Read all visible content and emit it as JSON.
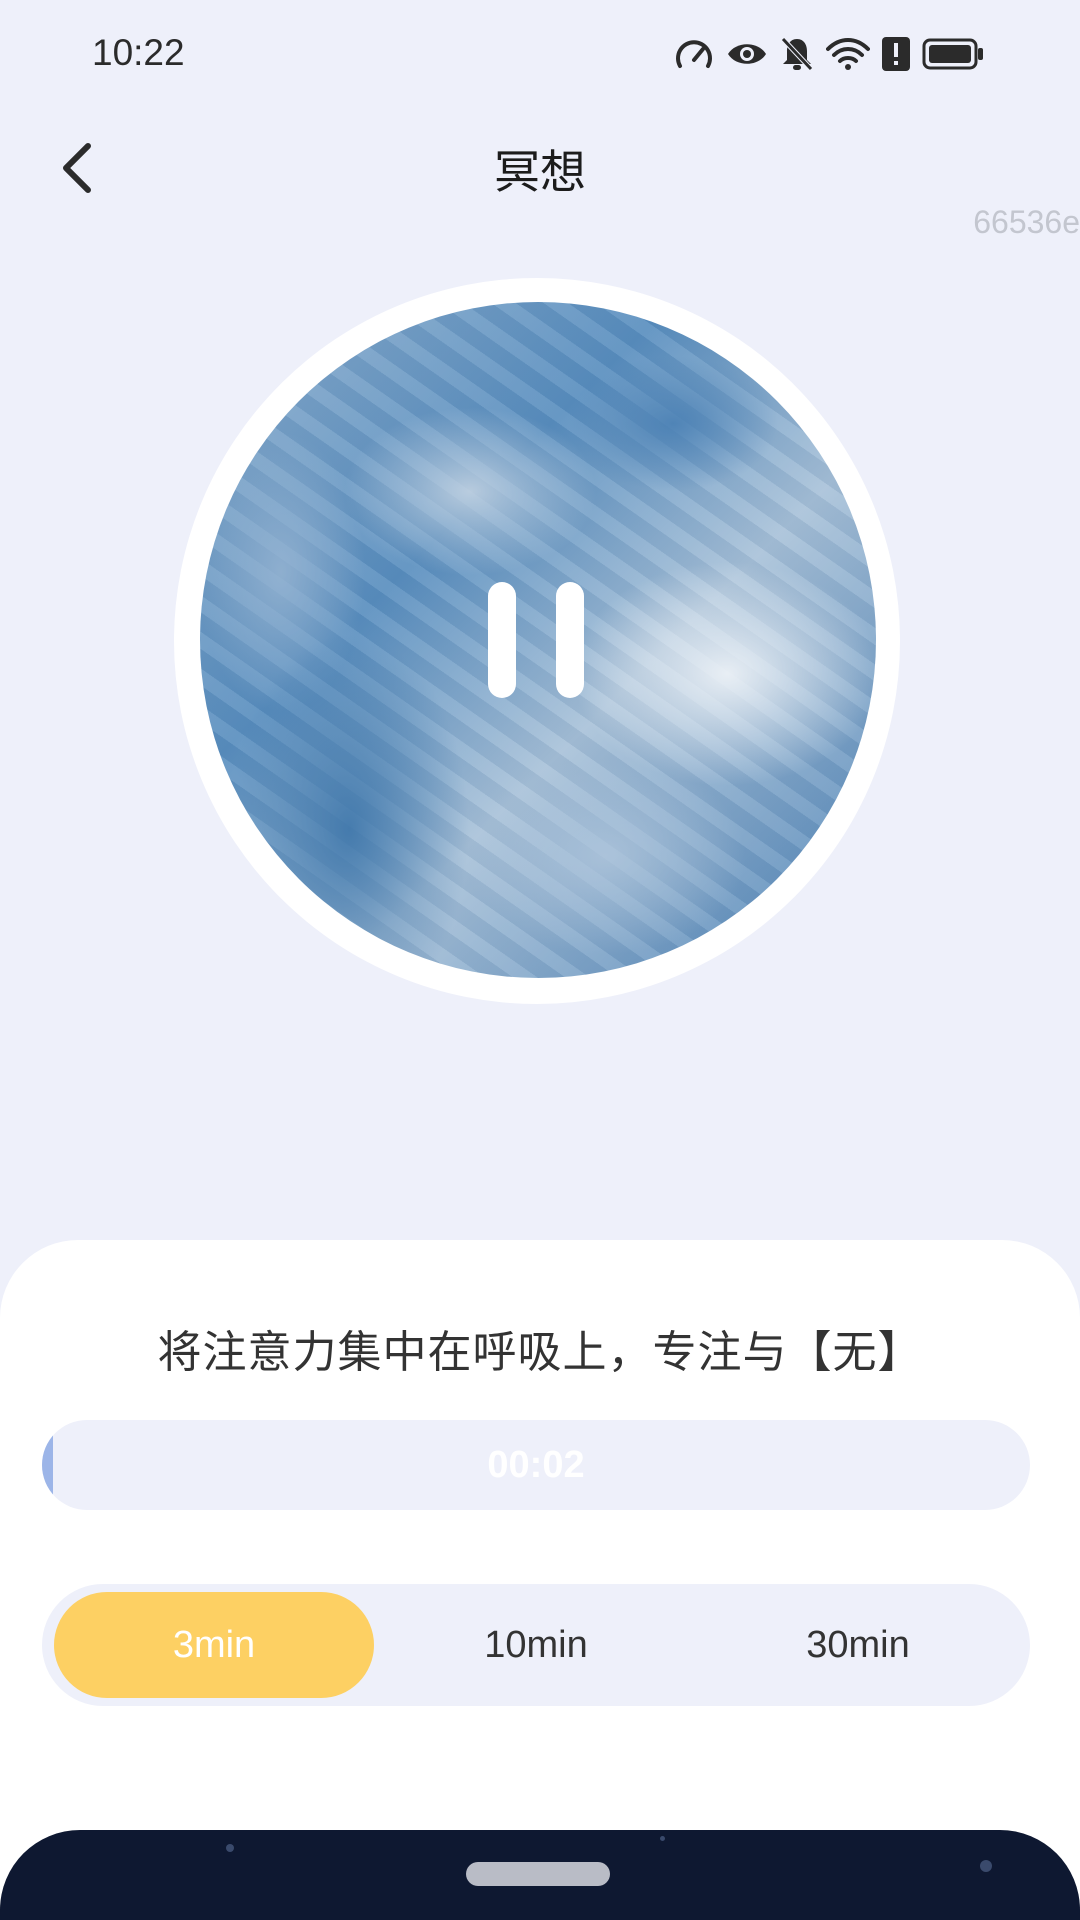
{
  "status_bar": {
    "time": "10:22",
    "icons": [
      "speedometer-icon",
      "eye-icon",
      "bell-off-icon",
      "wifi-icon",
      "alert-icon",
      "battery-icon"
    ]
  },
  "header": {
    "title": "冥想",
    "back_icon": "chevron-left-icon",
    "debug_id": "66536e"
  },
  "player": {
    "state_icon": "pause-icon"
  },
  "session": {
    "focus_text": "将注意力集中在呼吸上，专注与【无】",
    "elapsed": "00:02",
    "progress_fraction": 0.011
  },
  "durations": {
    "options": [
      "3min",
      "10min",
      "30min"
    ],
    "selected": "3min"
  },
  "colors": {
    "background": "#eef0fa",
    "accent_selected": "#fdd063",
    "progress_fill": "#9cb5e8",
    "dark_panel": "#0e1831"
  }
}
